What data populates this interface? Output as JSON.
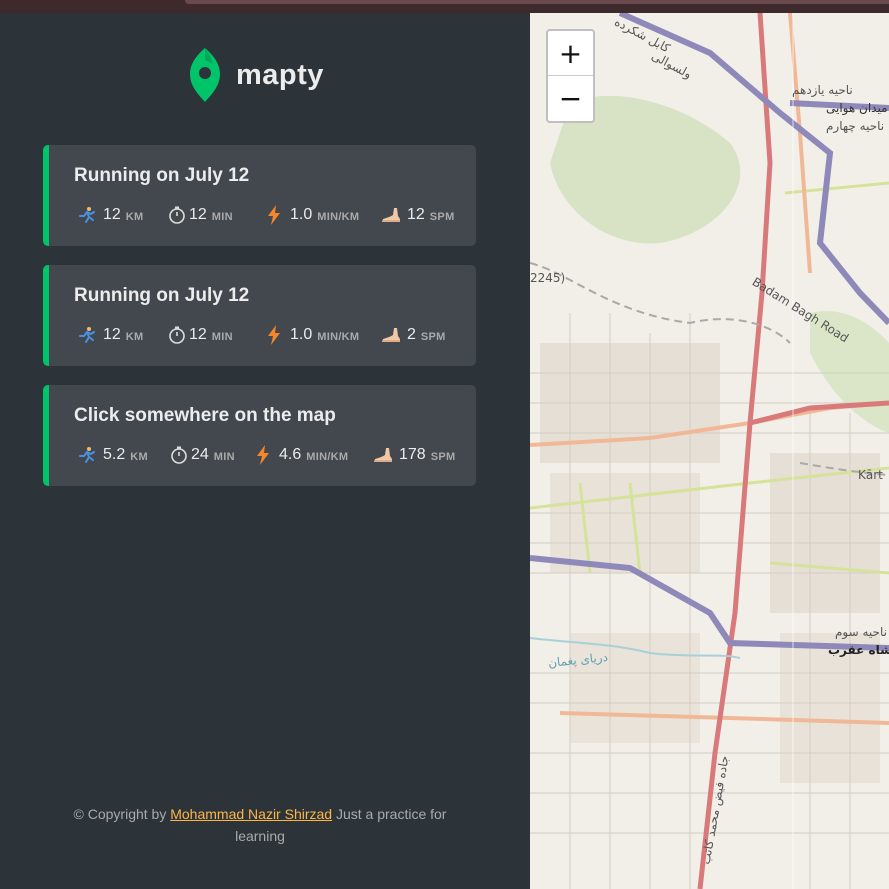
{
  "app": {
    "name": "mapty"
  },
  "workouts": [
    {
      "title": "Running on July 12",
      "distance": "12",
      "distance_unit": "KM",
      "duration": "12",
      "duration_unit": "MIN",
      "pace": "1.0",
      "pace_unit": "MIN/KM",
      "cadence": "12",
      "cadence_unit": "SPM"
    },
    {
      "title": "Running on July 12",
      "distance": "12",
      "distance_unit": "KM",
      "duration": "12",
      "duration_unit": "MIN",
      "pace": "1.0",
      "pace_unit": "MIN/KM",
      "cadence": "2",
      "cadence_unit": "SPM"
    },
    {
      "title": "Click somewhere on the map",
      "distance": "5.2",
      "distance_unit": "KM",
      "duration": "24",
      "duration_unit": "MIN",
      "pace": "4.6",
      "pace_unit": "MIN/KM",
      "cadence": "178",
      "cadence_unit": "SPM"
    }
  ],
  "footer": {
    "prefix": "© Copyright by",
    "author": "Mohammad Nazir Shirzad",
    "suffix": "Just a practice for learning"
  },
  "map": {
    "zoom_in": "+",
    "zoom_out": "−",
    "labels": {
      "road_badam": "Badam Bagh Road",
      "kart": "Kārt",
      "num_2245": "2245)",
      "fa_1": "ناحیه یازدهم",
      "fa_2": "میدان هوایی",
      "fa_3": "ناحیه چهارم",
      "fa_4": "کابل شکرده",
      "fa_5": "ولسوالی",
      "fa_6": "ناحیه سوم",
      "fa_7": "دریای پغمان",
      "fa_8": "شاه عقرب",
      "fa_9": "جاده فیض محمد کاتب"
    }
  },
  "colors": {
    "accent_running": "#00c46a",
    "sidebar_bg": "#2d3439",
    "card_bg": "#42484d",
    "link": "#ffb545"
  },
  "icons": {
    "distance": "running-person-icon",
    "duration": "stopwatch-icon",
    "pace": "lightning-icon",
    "cadence": "foot-icon"
  }
}
